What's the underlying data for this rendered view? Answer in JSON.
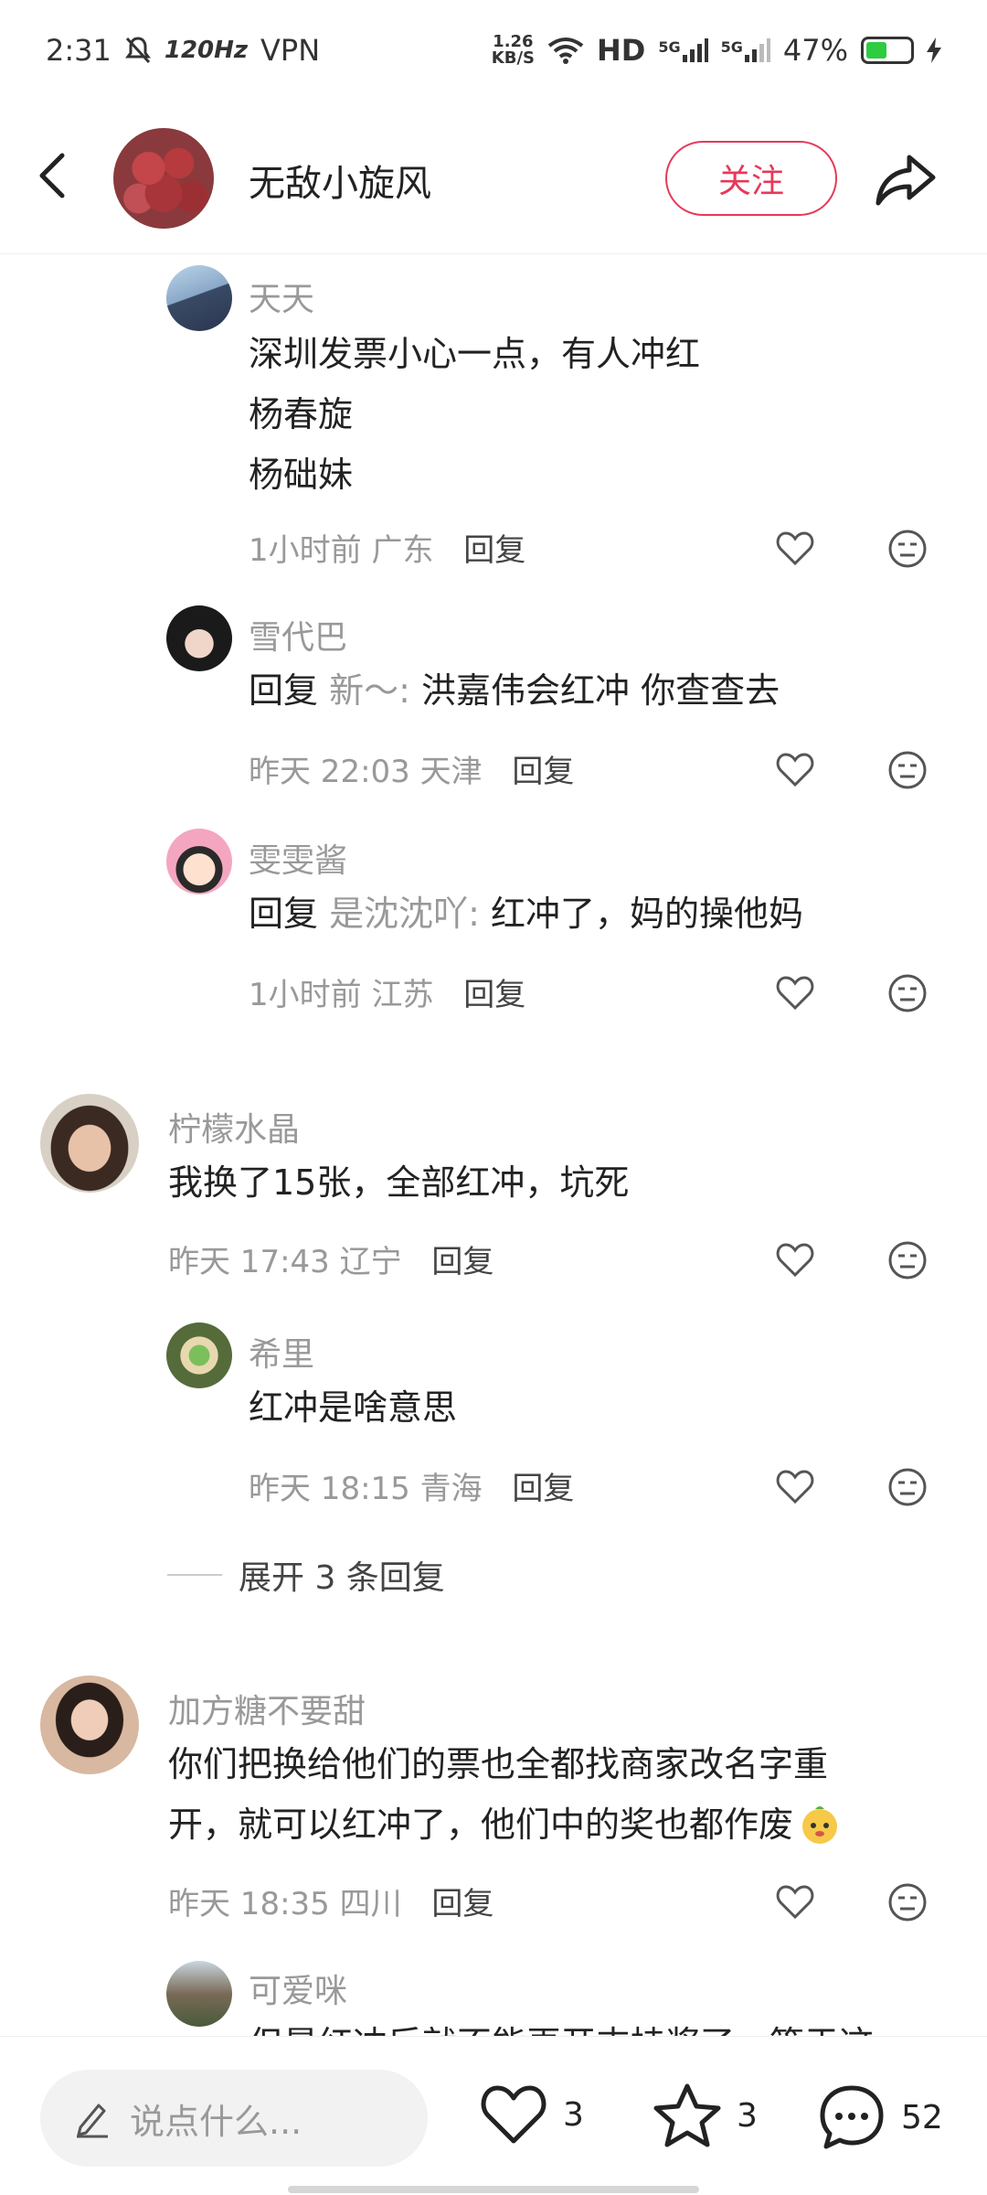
{
  "status_bar": {
    "time": "2:31",
    "refresh_rate": "120Hz",
    "vpn": "VPN",
    "net_speed_value": "1.26",
    "net_speed_unit": "KB/S",
    "hd_label": "HD",
    "signal_1": "5G",
    "signal_2": "5G",
    "battery_percent": "47%",
    "battery_level": 0.47
  },
  "header": {
    "title": "无敌小旋风",
    "follow_label": "关注"
  },
  "comments": [
    {
      "name": "天天",
      "lines": [
        "深圳发票小心一点，有人冲红",
        "杨春旋",
        "杨础妹"
      ],
      "time": "1小时前",
      "location": "广东",
      "reply_label": "回复"
    },
    {
      "name": "雪代巴",
      "reply_prefix": "回复",
      "reply_to": "新～:",
      "text": "洪嘉伟会红冲 你查查去",
      "time": "昨天 22:03",
      "location": "天津",
      "reply_label": "回复"
    },
    {
      "name": "雯雯酱",
      "reply_prefix": "回复",
      "reply_to": "是沈沈吖:",
      "text": "红冲了，妈的操他妈",
      "time": "1小时前",
      "location": "江苏",
      "reply_label": "回复"
    },
    {
      "name": "柠檬水晶",
      "text": "我换了15张，全部红冲，坑死",
      "time": "昨天 17:43",
      "location": "辽宁",
      "reply_label": "回复"
    },
    {
      "name": "希里",
      "text": "红冲是啥意思",
      "time": "昨天 18:15",
      "location": "青海",
      "reply_label": "回复"
    },
    {
      "name": "加方糖不要甜",
      "lines": [
        "你们把换给他们的票也全都找商家改名字重",
        "开，就可以红冲了，他们中的奖也都作废"
      ],
      "time": "昨天 18:35",
      "location": "四川",
      "reply_label": "回复"
    },
    {
      "name": "可爱咪",
      "text": "但是红冲后就不能再开支持奖了，等于这"
    }
  ],
  "expand_replies": "展开 3 条回复",
  "bottom_bar": {
    "input_placeholder": "说点什么...",
    "like_count": "3",
    "star_count": "3",
    "comment_count": "52"
  },
  "colors": {
    "accent": "#e6395a",
    "muted": "#999999",
    "text": "#222222"
  }
}
